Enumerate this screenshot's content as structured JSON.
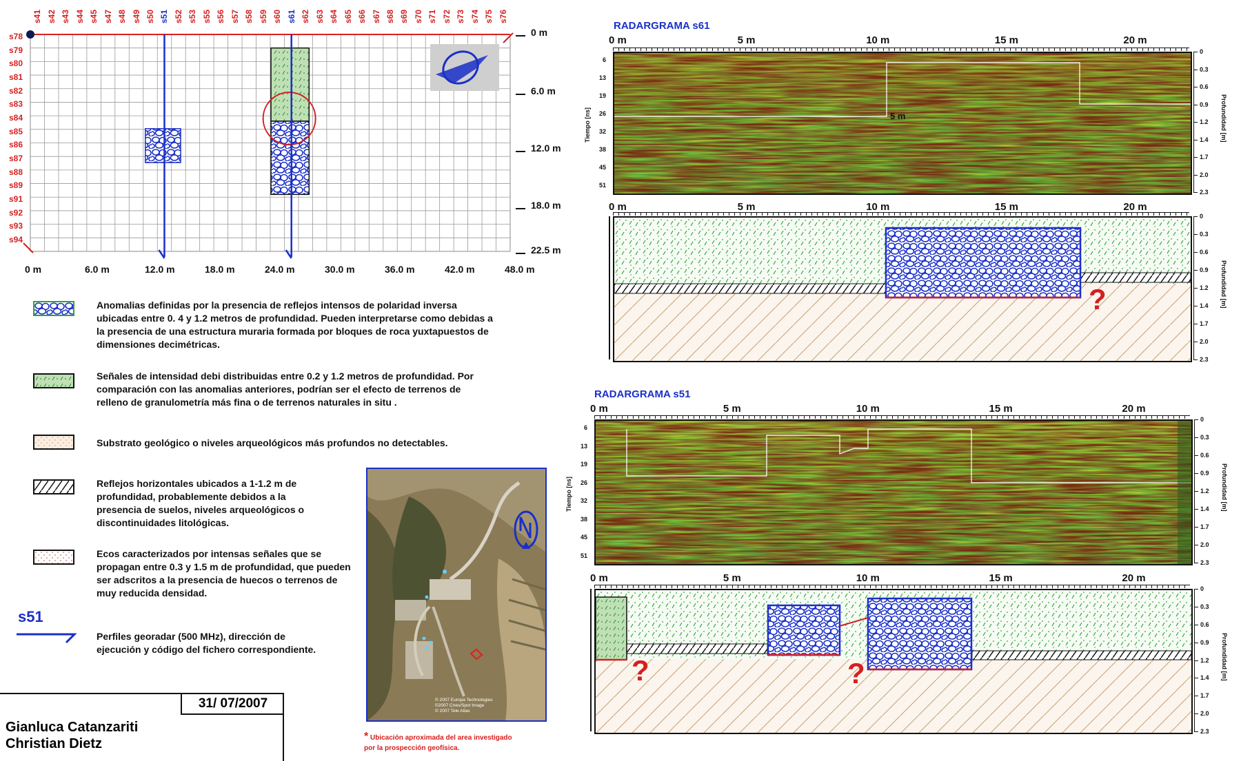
{
  "grid": {
    "columns": [
      "s41",
      "s42",
      "s43",
      "s44",
      "s45",
      "s47",
      "s48",
      "s49",
      "s50",
      "s51",
      "s52",
      "s53",
      "s55",
      "s56",
      "s57",
      "s58",
      "s59",
      "s60",
      "s61",
      "s62",
      "s63",
      "s64",
      "s65",
      "s66",
      "s67",
      "s68",
      "s69",
      "s70",
      "s71",
      "s72",
      "s73",
      "s74",
      "s75",
      "s76"
    ],
    "highlight_columns": [
      "s51",
      "s61"
    ],
    "rows": [
      "s78",
      "s79",
      "s80",
      "s81",
      "s82",
      "s83",
      "s84",
      "s85",
      "s86",
      "s87",
      "s88",
      "s89",
      "s91",
      "s92",
      "s93",
      "s94"
    ],
    "x_ticks": [
      "0 m",
      "6.0 m",
      "12.0 m",
      "18.0 m",
      "24.0 m",
      "30.0 m",
      "36.0 m",
      "42.0 m",
      "48.0 m"
    ],
    "y_ticks": [
      "0 m",
      "6.0 m",
      "12.0 m",
      "18.0 m",
      "22.5 m"
    ]
  },
  "legend": [
    {
      "text": "Anomalias definidas por la presencia de reflejos intensos de polaridad inversa ubicadas   entre 0. 4 y  1.2 metros de profundidad. Pueden interpretarse como debidas a la presencia de una estructura muraria formada por bloques de roca  yuxtapuestos de dimensiones decimétricas."
    },
    {
      "text": "Señales de intensidad debi distribuidas entre 0.2 y  1.2 metros de profundidad. Por comparación con las  anomalias anteriores, podrían ser el efecto de terrenos de relleno de granulometría más fina o de terrenos naturales in situ ."
    },
    {
      "text": "Substrato geológico o niveles arqueológicos más profundos no detectables."
    },
    {
      "text": "Reflejos horizontales ubicados a 1-1.2 m  de profundidad, probablemente debidos a la presencia de suelos, niveles arqueológicos o discontinuidades litológicas."
    },
    {
      "text": "Ecos caracterizados por intensas señales que se propagan entre 0.3 y 1.5 m de profundidad, que pueden ser adscritos a la presencia de huecos o terrenos de muy reducida densidad."
    },
    {
      "text": "Perfiles georadar (500 MHz), dirección de ejecución y código del fichero correspondiente."
    }
  ],
  "profile_label": "s51",
  "date": "31/ 07/2007",
  "authors": [
    "Gianluca Catanzariti",
    "Christian Dietz"
  ],
  "map": {
    "credits": [
      "© 2007 Europa Technologies",
      "©2007 Cnes/Spot Image",
      "© 2007 Tele Atlas"
    ],
    "note_star": "*",
    "note": [
      "Ubicación aproximada del area investigado",
      "por la prospección geofísica."
    ]
  },
  "radar": [
    {
      "title": "RADARGRAMA s61",
      "x_ticks": [
        "0 m",
        "5 m",
        "10 m",
        "15 m",
        "20 m"
      ],
      "time_ticks": [
        "6",
        "13",
        "19",
        "26",
        "32",
        "38",
        "45",
        "51"
      ],
      "depth_ticks": [
        "0",
        "0.3",
        "0.6",
        "0.9",
        "1.2",
        "1.4",
        "1.7",
        "2.0",
        "2.3"
      ],
      "time_label": "Tiempo [ns]",
      "depth_label": "Profundidad [m]",
      "inline_note": "5 m"
    },
    {
      "title": "RADARGRAMA s51",
      "x_ticks": [
        "0 m",
        "5 m",
        "10 m",
        "15 m",
        "20 m"
      ],
      "time_ticks": [
        "6",
        "13",
        "19",
        "26",
        "32",
        "38",
        "45",
        "51"
      ],
      "depth_ticks": [
        "0",
        "0.3",
        "0.6",
        "0.9",
        "1.2",
        "1.4",
        "1.7",
        "2.0",
        "2.3"
      ],
      "time_label": "Tiempo [ns]",
      "depth_label": "Profundidad [m]"
    }
  ],
  "interp_depth_ticks": [
    "0",
    "0.3",
    "0.6",
    "0.9",
    "1.2",
    "1.4",
    "1.7",
    "2.0",
    "2.3"
  ],
  "interp_depth_label": "Profundidad [m]",
  "question_mark": "?",
  "colors": {
    "red": "#d42020",
    "blue": "#1a2fc8",
    "green": "#2fa33a",
    "sand": "#c9a57a"
  }
}
